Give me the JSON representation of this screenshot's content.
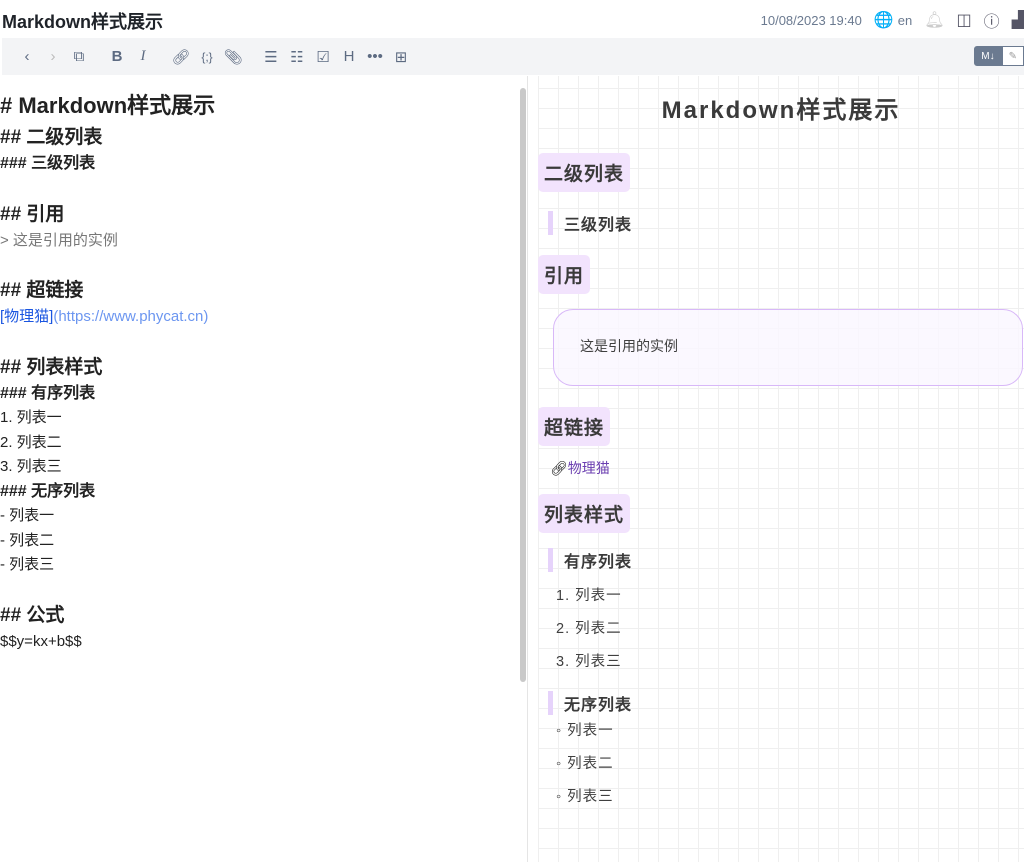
{
  "header": {
    "title": "Markdown样式展示",
    "datetime": "10/08/2023 19:40",
    "lang": "en"
  },
  "toolbar": {
    "icons": [
      "back-icon",
      "forward-icon",
      "open-external-icon",
      "bold-icon",
      "italic-icon",
      "link-icon",
      "code-icon",
      "attachment-icon",
      "bullet-list-icon",
      "numbered-list-icon",
      "checklist-icon",
      "heading-icon",
      "more-icon",
      "insert-date-icon"
    ],
    "mode_markdown": "M↓"
  },
  "editor": {
    "lines": [
      "# Markdown样式展示",
      "## 二级列表",
      "### 三级列表",
      "## 引用",
      "> 这是引用的实例",
      "## 超链接",
      "[物理猫]",
      "(https://www.phycat.cn)",
      "## 列表样式",
      "### 有序列表",
      "1. 列表一",
      "2. 列表二",
      "3. 列表三",
      "### 无序列表",
      "- 列表一",
      "- 列表二",
      "- 列表三",
      "## 公式",
      "$$y=kx+b$$"
    ]
  },
  "preview": {
    "title": "Markdown样式展示",
    "h2_list": "二级列表",
    "h3_list": "三级列表",
    "h2_quote": "引用",
    "quote": "这是引用的实例",
    "h2_link": "超链接",
    "link": "物理猫",
    "h2_lists": "列表样式",
    "h3_ordered": "有序列表",
    "ordered": [
      "1. 列表一",
      "2. 列表二",
      "3. 列表三"
    ],
    "h3_unordered": "无序列表",
    "unordered": [
      "◦ 列表一",
      "◦ 列表二",
      "◦ 列表三"
    ]
  },
  "colors": {
    "heading_bg": "#f2e3fd",
    "quote_border": "#d8b8f8",
    "link": "#6b3fb0",
    "editor_link": "#1a55e0"
  }
}
